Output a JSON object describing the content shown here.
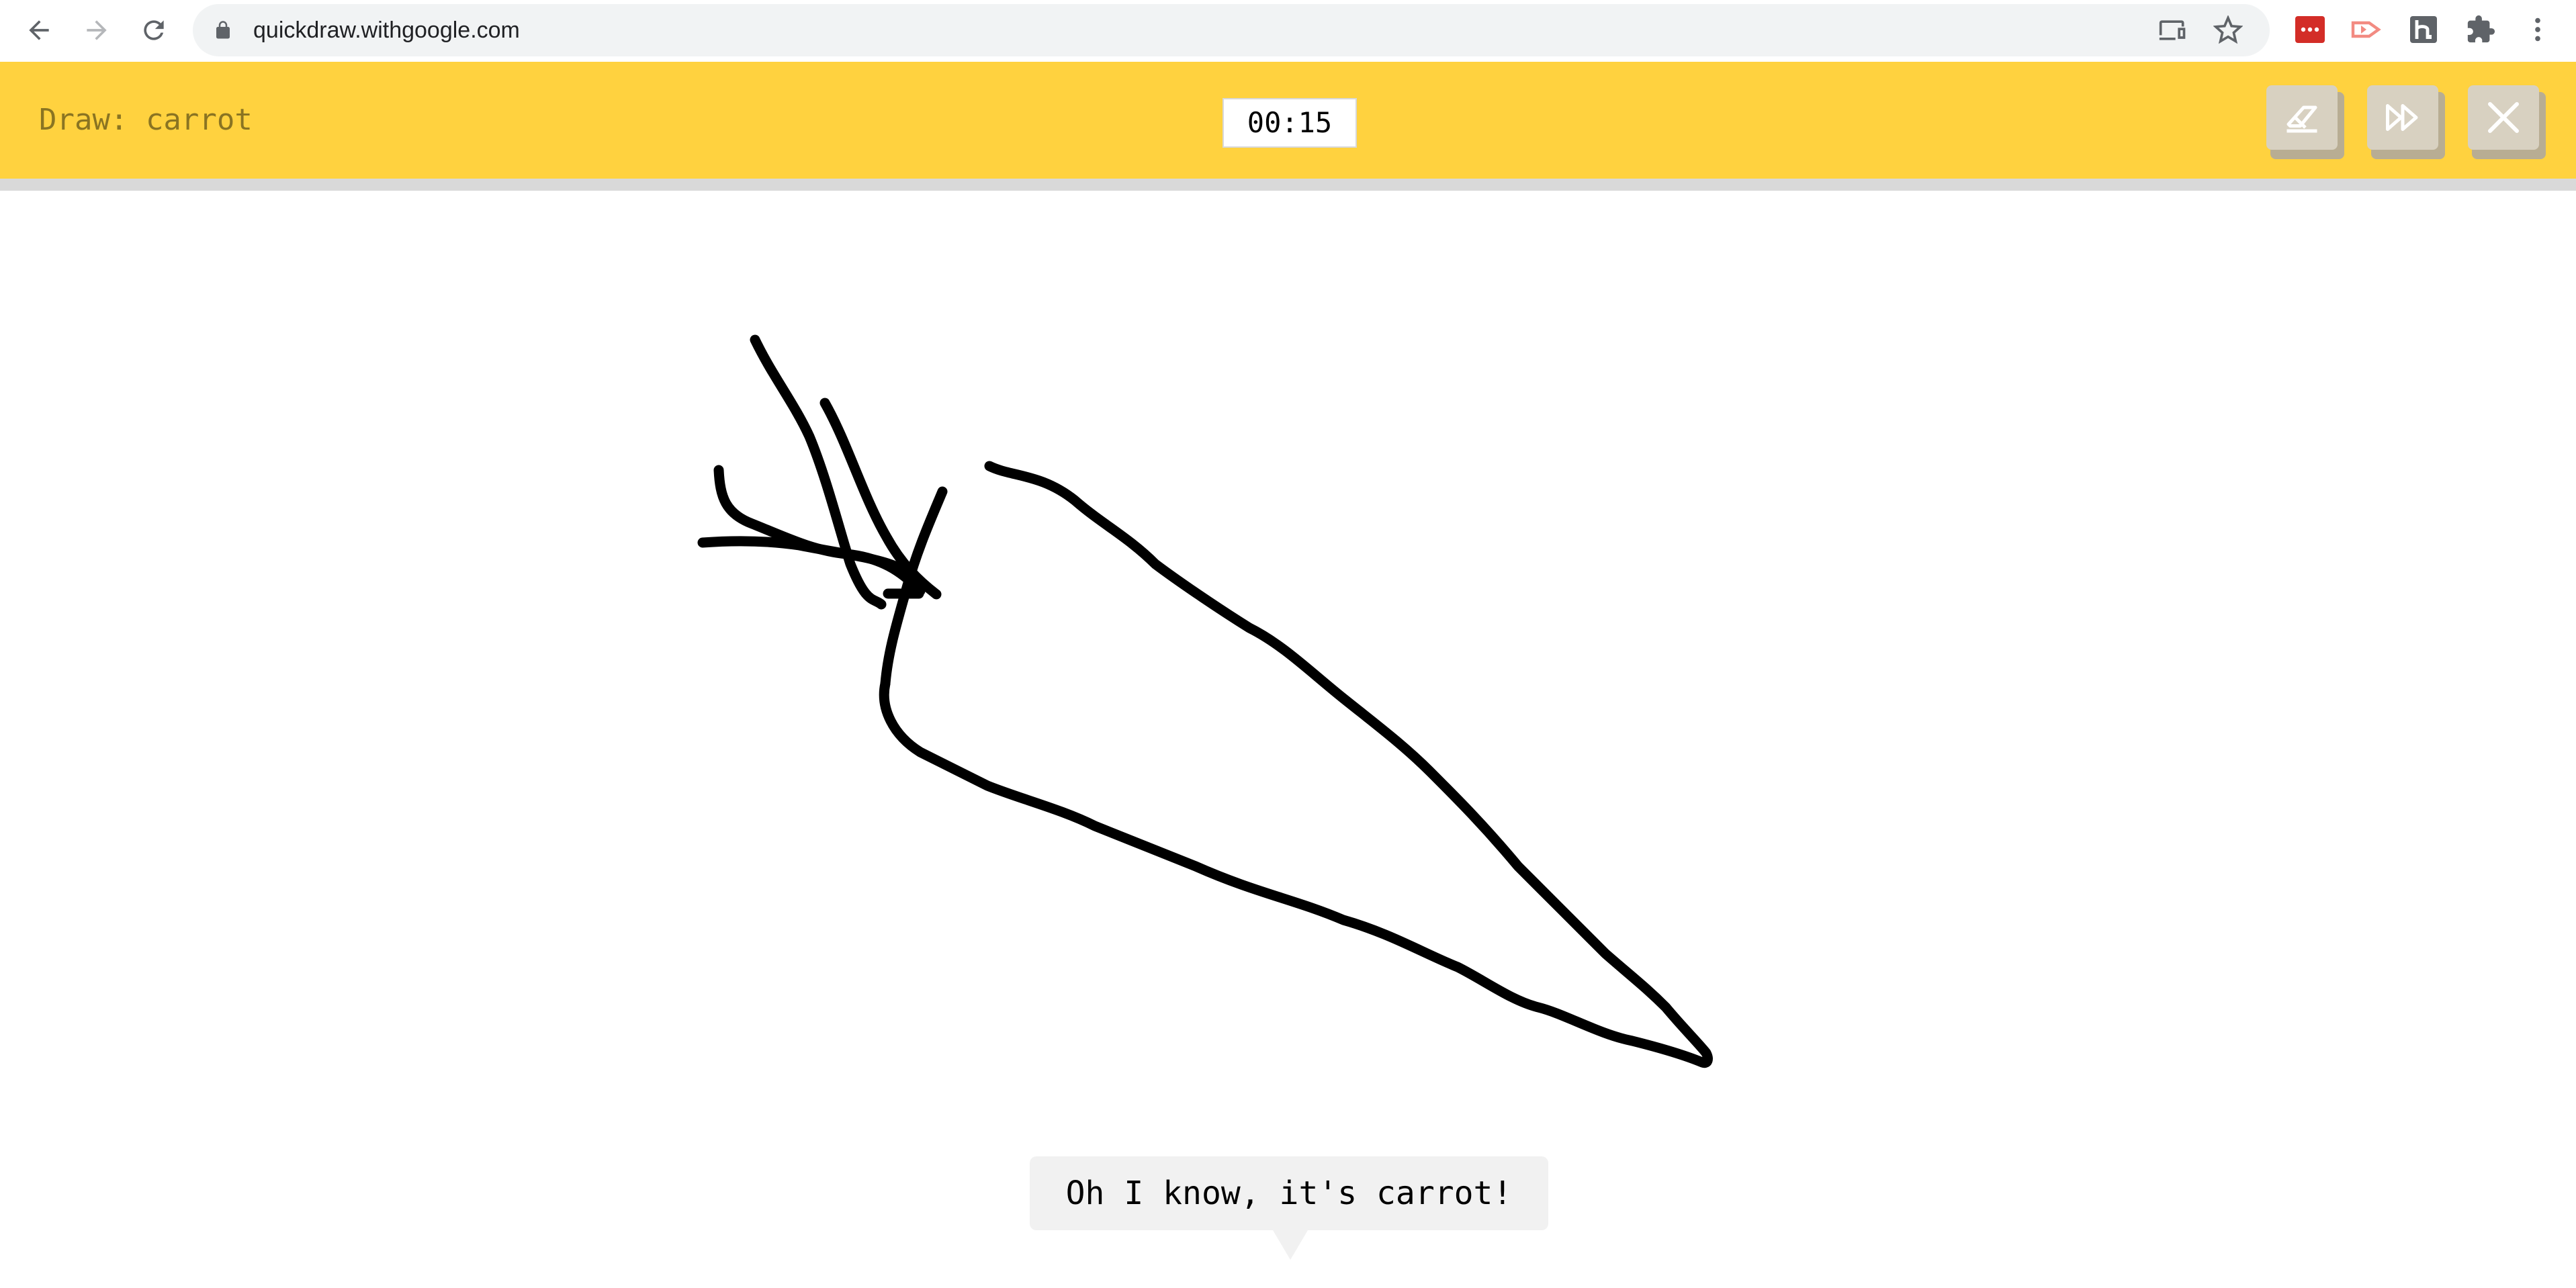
{
  "browser": {
    "url": "quickdraw.withgoogle.com",
    "icons": {
      "back": "arrow-left-icon",
      "forward": "arrow-right-icon",
      "reload": "reload-icon",
      "lock": "lock-icon",
      "cast": "cast-icon",
      "bookmark": "star-icon",
      "extensions": [
        "lastpass-icon",
        "ext-red-arrow-icon",
        "honey-icon",
        "puzzle-icon"
      ],
      "menu": "kebab-menu-icon"
    }
  },
  "game": {
    "prompt": "Draw: carrot",
    "timer": "00:15",
    "buttons": {
      "clear": "eraser-icon",
      "skip": "fast-forward-icon",
      "close": "close-icon"
    }
  },
  "bubble": {
    "text": "Oh I know, it's carrot!"
  },
  "colors": {
    "header": "#ffd23f",
    "prompt_text": "#8a7422",
    "stroke": "#000000",
    "button_face": "#d8d1c1",
    "bubble_bg": "#f1f1f1"
  }
}
